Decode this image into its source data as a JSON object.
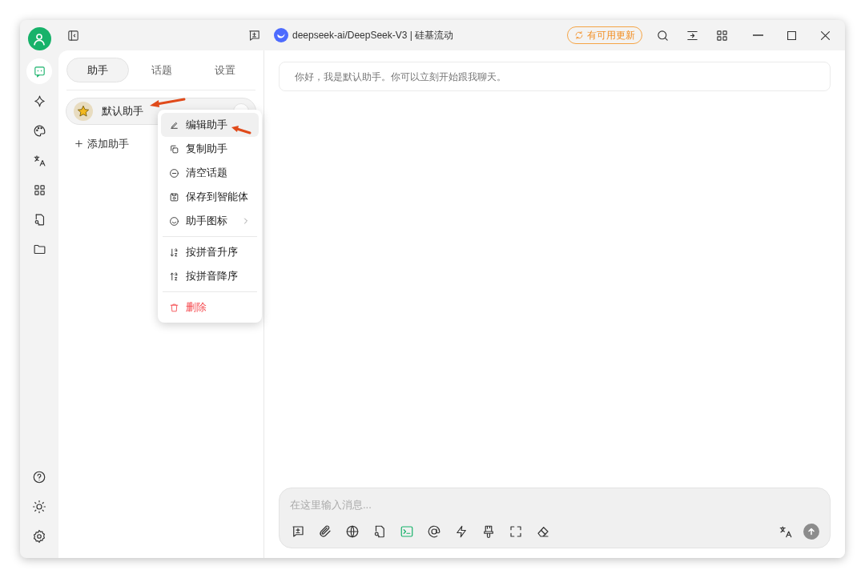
{
  "window": {
    "title": "deepseek-ai/DeepSeek-V3 | 硅基流动",
    "update_badge": "有可用更新"
  },
  "rail": {
    "items": [
      {
        "selected": true
      },
      {
        "selected": false
      },
      {
        "selected": false
      },
      {
        "selected": false
      },
      {
        "selected": false
      },
      {
        "selected": false
      },
      {
        "selected": false
      }
    ]
  },
  "panel": {
    "tabs": [
      {
        "label": "助手",
        "selected": true
      },
      {
        "label": "话题",
        "selected": false
      },
      {
        "label": "设置",
        "selected": false
      }
    ],
    "assistants": [
      {
        "name": "默认助手",
        "selected": true
      }
    ],
    "add_button": "添加助手"
  },
  "context_menu": {
    "groups": [
      [
        {
          "label": "编辑助手",
          "kind": "normal",
          "selected": true,
          "submenu": false
        },
        {
          "label": "复制助手",
          "kind": "normal",
          "selected": false,
          "submenu": false
        },
        {
          "label": "清空话题",
          "kind": "normal",
          "selected": false,
          "submenu": false
        },
        {
          "label": "保存到智能体",
          "kind": "normal",
          "selected": false,
          "submenu": false
        },
        {
          "label": "助手图标",
          "kind": "normal",
          "selected": false,
          "submenu": true
        }
      ],
      [
        {
          "label": "按拼音升序",
          "kind": "normal",
          "selected": false,
          "submenu": false
        },
        {
          "label": "按拼音降序",
          "kind": "normal",
          "selected": false,
          "submenu": false
        }
      ],
      [
        {
          "label": "删除",
          "kind": "danger",
          "selected": false,
          "submenu": false
        }
      ]
    ]
  },
  "chat": {
    "welcome": "你好，我是默认助手。你可以立刻开始跟我聊天。",
    "input": {
      "placeholder": "在这里输入消息..."
    },
    "tools": [
      {
        "active": false
      },
      {
        "active": false
      },
      {
        "active": false
      },
      {
        "active": false
      },
      {
        "active": true
      },
      {
        "active": false
      },
      {
        "active": false
      },
      {
        "active": false
      },
      {
        "active": false
      },
      {
        "active": false
      }
    ]
  }
}
